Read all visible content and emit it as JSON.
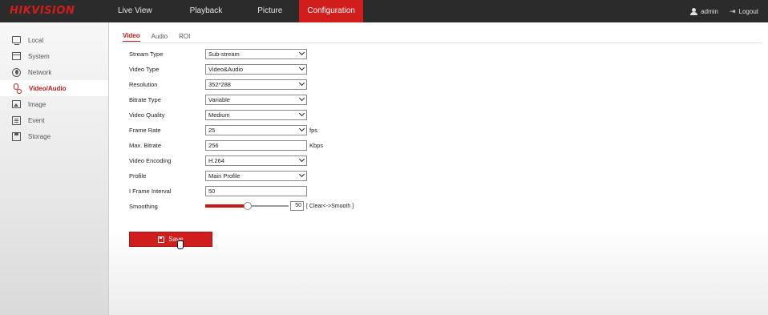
{
  "brand": "HIKVISION",
  "nav": {
    "items": [
      "Live View",
      "Playback",
      "Picture",
      "Configuration"
    ],
    "active": "Configuration"
  },
  "user": {
    "name": "admin",
    "logout": "Logout"
  },
  "sidebar": {
    "items": [
      {
        "label": "Local",
        "icon": "monitor-icon"
      },
      {
        "label": "System",
        "icon": "system-icon"
      },
      {
        "label": "Network",
        "icon": "network-icon"
      },
      {
        "label": "Video/Audio",
        "icon": "video-audio-icon"
      },
      {
        "label": "Image",
        "icon": "image-icon"
      },
      {
        "label": "Event",
        "icon": "event-icon"
      },
      {
        "label": "Storage",
        "icon": "storage-icon"
      }
    ],
    "active": "Video/Audio"
  },
  "tabs": [
    "Video",
    "Audio",
    "ROI"
  ],
  "active_tab": "Video",
  "form": {
    "stream_type": {
      "label": "Stream Type",
      "value": "Sub-stream"
    },
    "video_type": {
      "label": "Video Type",
      "value": "Video&Audio"
    },
    "resolution": {
      "label": "Resolution",
      "value": "352*288"
    },
    "bitrate_type": {
      "label": "Bitrate Type",
      "value": "Variable"
    },
    "video_quality": {
      "label": "Video Quality",
      "value": "Medium"
    },
    "frame_rate": {
      "label": "Frame Rate",
      "value": "25",
      "unit": "fps"
    },
    "max_bitrate": {
      "label": "Max. Bitrate",
      "value": "256",
      "unit": "Kbps"
    },
    "video_encoding": {
      "label": "Video Encoding",
      "value": "H.264"
    },
    "profile": {
      "label": "Profile",
      "value": "Main Profile"
    },
    "i_frame_interval": {
      "label": "I Frame Interval",
      "value": "50"
    },
    "smoothing": {
      "label": "Smoothing",
      "value": "50",
      "hint": "[ Clear<->Smooth ]",
      "level": 0.5
    }
  },
  "save_label": "Save",
  "colors": {
    "accent": "#c31a1a",
    "topbar": "#2b2b2b"
  }
}
